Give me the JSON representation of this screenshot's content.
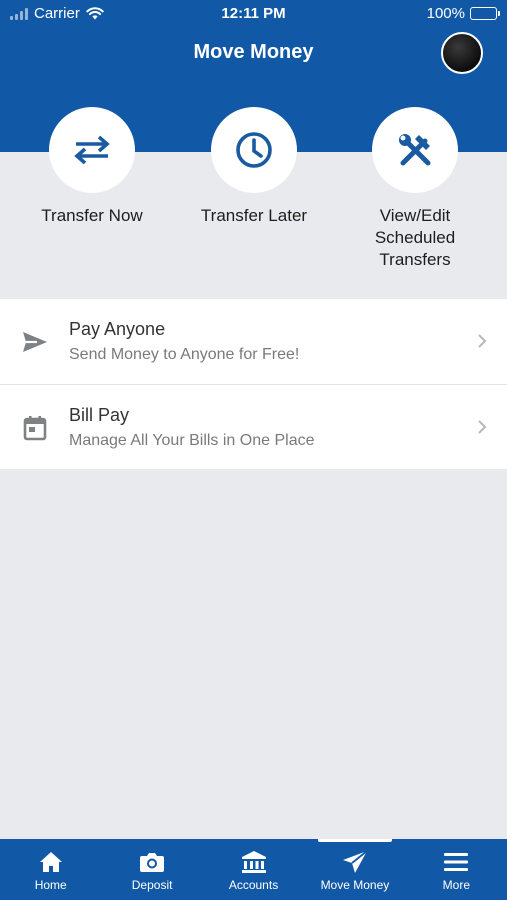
{
  "status_bar": {
    "carrier": "Carrier",
    "time": "12:11 PM",
    "battery": "100%"
  },
  "header": {
    "title": "Move Money"
  },
  "quick_actions": [
    {
      "label": "Transfer Now",
      "icon": "transfer-arrows-icon"
    },
    {
      "label": "Transfer Later",
      "icon": "clock-icon"
    },
    {
      "label": "View/Edit\nScheduled\nTransfers",
      "icon": "tools-icon"
    }
  ],
  "list": [
    {
      "title": "Pay Anyone",
      "subtitle": "Send Money to Anyone for Free!",
      "icon": "send-icon"
    },
    {
      "title": "Bill Pay",
      "subtitle": "Manage All Your Bills in One Place",
      "icon": "calendar-icon"
    }
  ],
  "tabbar": {
    "active": "Move Money",
    "items": [
      {
        "label": "Home",
        "icon": "home-icon"
      },
      {
        "label": "Deposit",
        "icon": "camera-icon"
      },
      {
        "label": "Accounts",
        "icon": "bank-icon"
      },
      {
        "label": "Move Money",
        "icon": "paper-plane-icon"
      },
      {
        "label": "More",
        "icon": "menu-icon"
      }
    ]
  },
  "colors": {
    "brand_blue": "#1159a6",
    "icon_blue": "#1a5aa0",
    "background": "#e9eaed"
  }
}
